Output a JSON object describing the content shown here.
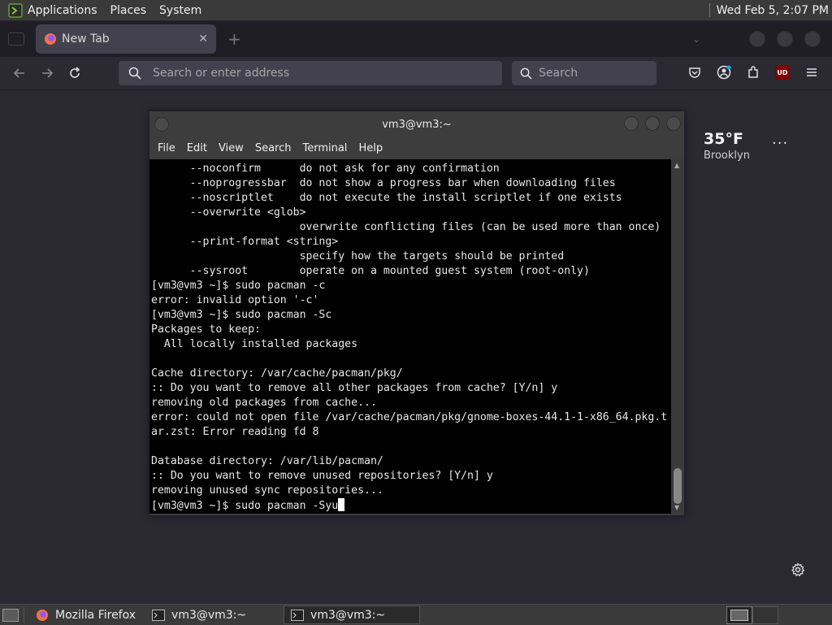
{
  "top_panel": {
    "menus": [
      "Applications",
      "Places",
      "System"
    ],
    "clock": "Wed Feb  5,  2:07 PM"
  },
  "browser": {
    "tab": {
      "title": "New Tab",
      "close_glyph": "✕"
    },
    "new_tab_glyph": "+",
    "url_placeholder": "Search or enter address",
    "search_placeholder": "Search",
    "toolbar_icons": [
      "pocket-icon",
      "account-icon",
      "extensions-icon",
      "ublock-origin-icon",
      "menu-icon"
    ],
    "ublock_badge": "UD"
  },
  "newtab": {
    "weather": {
      "temperature": "35°F",
      "location": "Brooklyn"
    },
    "more_glyph": "···"
  },
  "terminal": {
    "title": "vm3@vm3:~",
    "menus": [
      "File",
      "Edit",
      "View",
      "Search",
      "Terminal",
      "Help"
    ],
    "lines": [
      "      --noconfirm      do not ask for any confirmation",
      "      --noprogressbar  do not show a progress bar when downloading files",
      "      --noscriptlet    do not execute the install scriptlet if one exists",
      "      --overwrite <glob>",
      "                       overwrite conflicting files (can be used more than once)",
      "      --print-format <string>",
      "                       specify how the targets should be printed",
      "      --sysroot        operate on a mounted guest system (root-only)",
      "[vm3@vm3 ~]$ sudo pacman -c",
      "error: invalid option '-c'",
      "[vm3@vm3 ~]$ sudo pacman -Sc",
      "Packages to keep:",
      "  All locally installed packages",
      "",
      "Cache directory: /var/cache/pacman/pkg/",
      ":: Do you want to remove all other packages from cache? [Y/n] y",
      "removing old packages from cache...",
      "error: could not open file /var/cache/pacman/pkg/gnome-boxes-44.1-1-x86_64.pkg.t",
      "ar.zst: Error reading fd 8",
      "",
      "Database directory: /var/lib/pacman/",
      ":: Do you want to remove unused repositories? [Y/n] y",
      "removing unused sync repositories..."
    ],
    "prompt_line": "[vm3@vm3 ~]$ sudo pacman -Syu"
  },
  "taskbar": {
    "tasks": [
      {
        "label": "Mozilla Firefox",
        "icon": "firefox-icon",
        "active": false
      },
      {
        "label": "vm3@vm3:~",
        "icon": "terminal-icon",
        "active": false
      },
      {
        "label": "vm3@vm3:~",
        "icon": "terminal-icon",
        "active": true
      }
    ]
  }
}
